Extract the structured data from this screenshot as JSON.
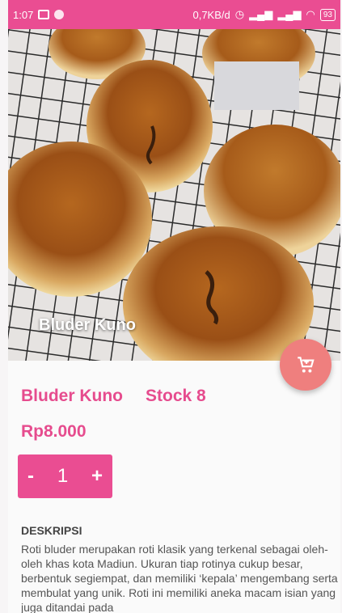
{
  "status_bar": {
    "time": "1:07",
    "network_speed": "0,7KB/d",
    "battery": "93"
  },
  "product": {
    "image_caption": "Bluder Kuno",
    "name": "Bluder Kuno",
    "stock_label": "Stock 8",
    "price": "Rp8.000",
    "quantity": "1",
    "decrease_label": "-",
    "increase_label": "+"
  },
  "description": {
    "heading": "DESKRIPSI",
    "text": "Roti bluder merupakan roti klasik yang terkenal sebagai oleh-oleh khas kota Madiun. Ukuran tiap rotinya cukup besar, berbentuk segiempat, dan memiliki ‘kepala’ mengembang serta membulat yang unik. Roti ini memiliki aneka macam isian yang juga ditandai pada"
  },
  "fab": {
    "icon": "cart-icon"
  },
  "colors": {
    "accent": "#ea4d92",
    "fab": "#ef7f7e",
    "text_pink": "#e64c8e"
  }
}
